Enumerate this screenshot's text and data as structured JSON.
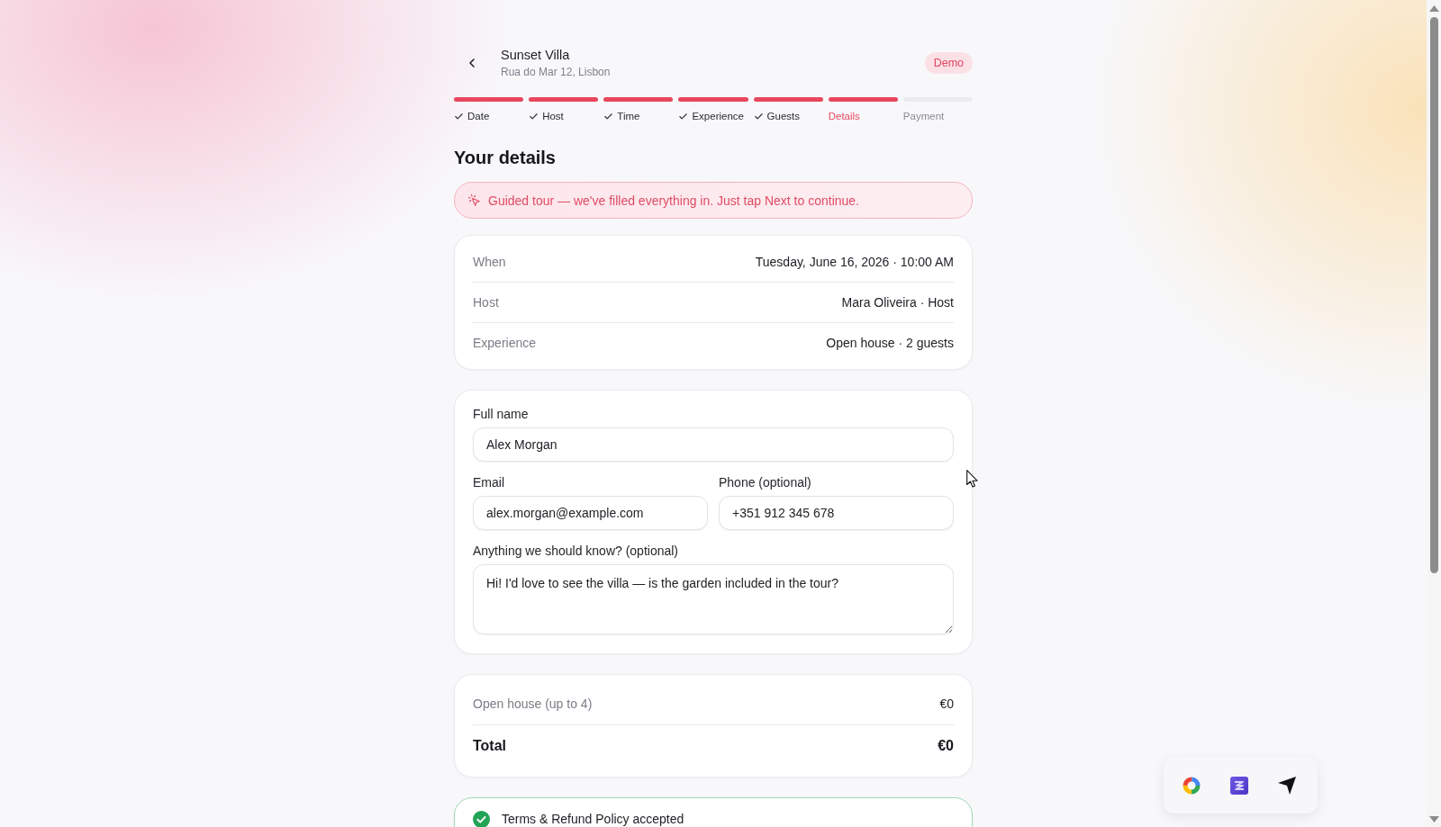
{
  "header": {
    "title": "Sunset Villa",
    "subtitle": "Rua do Mar 12, Lisbon",
    "badge": "Demo"
  },
  "steps": [
    {
      "label": "Date",
      "completed": true,
      "selected": false,
      "filled": true
    },
    {
      "label": "Host",
      "completed": true,
      "selected": false,
      "filled": true
    },
    {
      "label": "Time",
      "completed": true,
      "selected": false,
      "filled": true
    },
    {
      "label": "Experience",
      "completed": true,
      "selected": false,
      "filled": true
    },
    {
      "label": "Guests",
      "completed": true,
      "selected": false,
      "filled": true
    },
    {
      "label": "Details",
      "completed": false,
      "selected": true,
      "filled": true
    },
    {
      "label": "Payment",
      "completed": false,
      "selected": false,
      "filled": false
    }
  ],
  "heading": "Your details",
  "banner": "Guided tour — we've filled everything in. Just tap Next to continue.",
  "summary": [
    {
      "label": "When",
      "value": "Tuesday, June 16, 2026 · 10:00 AM"
    },
    {
      "label": "Host",
      "value": "Mara Oliveira · Host"
    },
    {
      "label": "Experience",
      "value": "Open house · 2 guests"
    }
  ],
  "form": {
    "rows": [
      {
        "fields": [
          {
            "kind": "input",
            "label": "Full name",
            "value": "Alex Morgan"
          }
        ]
      },
      {
        "fields": [
          {
            "kind": "input",
            "label": "Email",
            "value": "alex.morgan@example.com"
          },
          {
            "kind": "input",
            "label": "Phone (optional)",
            "value": "+351 912 345 678"
          }
        ]
      },
      {
        "fields": [
          {
            "kind": "textarea",
            "label": "Anything we should know? (optional)",
            "value": "Hi! I'd love to see the villa — is the garden included in the tour?"
          }
        ]
      }
    ]
  },
  "pricing": {
    "lines": [
      {
        "label": "Open house (up to 4)",
        "amount": "€0"
      }
    ],
    "total": {
      "label": "Total",
      "amount": "€0"
    }
  },
  "terms": {
    "text": "Terms & Refund Policy accepted",
    "accepted": true
  }
}
